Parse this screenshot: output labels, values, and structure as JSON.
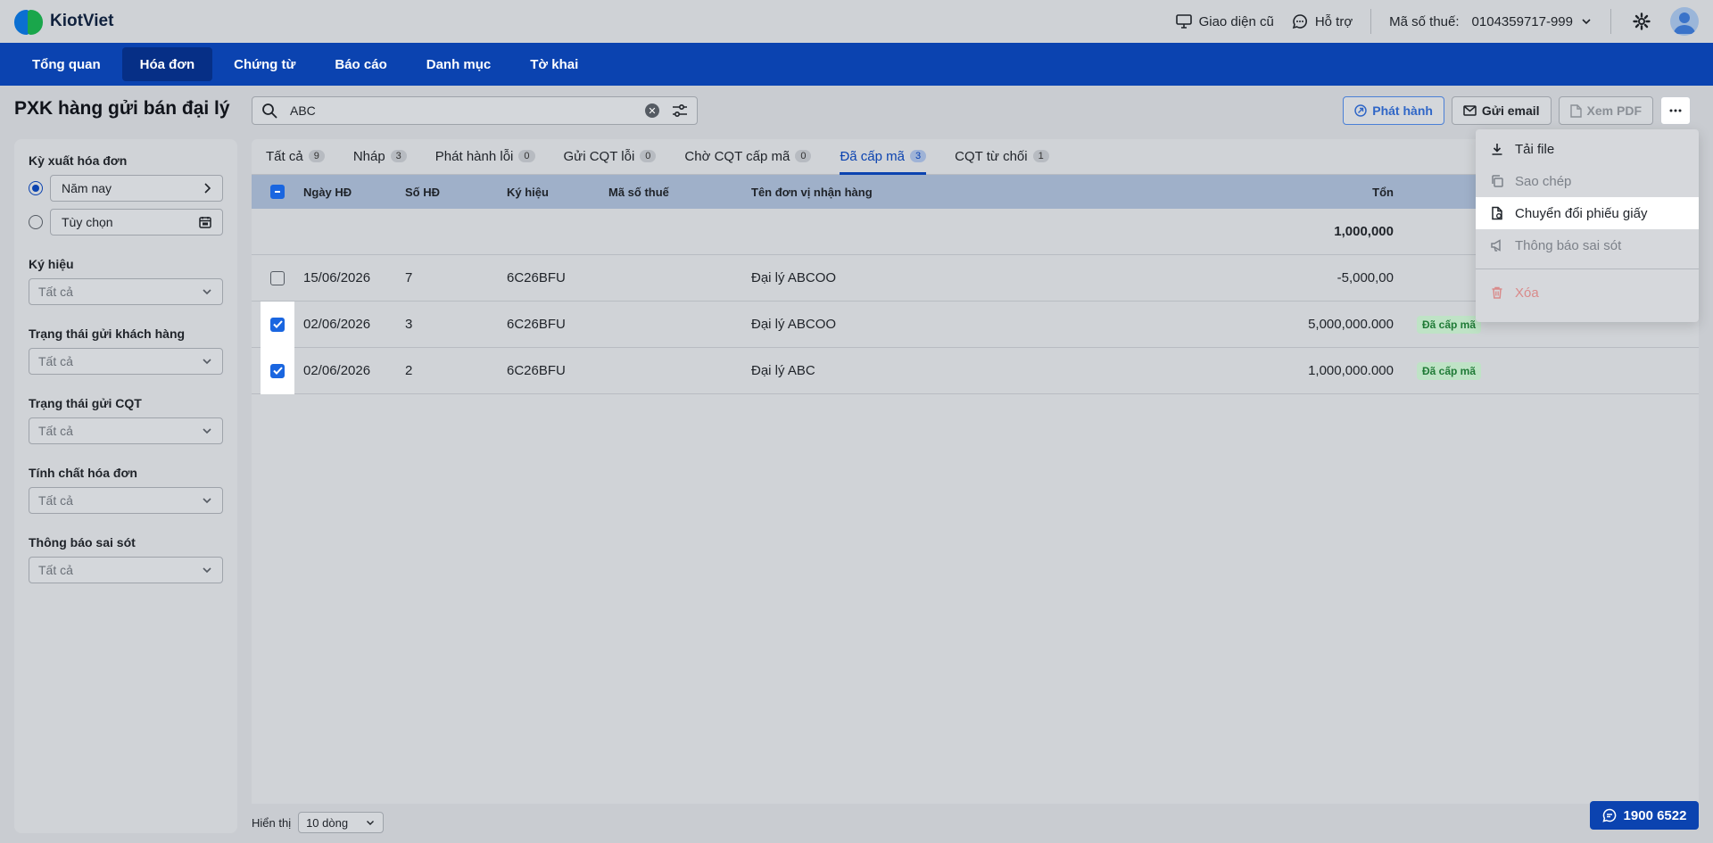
{
  "brand": {
    "name": "KiotViet"
  },
  "header": {
    "old_ui": "Giao diện cũ",
    "support": "Hỗ trợ",
    "tax_label": "Mã số thuế:",
    "tax_value": "0104359717-999"
  },
  "nav": {
    "items": [
      "Tổng quan",
      "Hóa đơn",
      "Chứng từ",
      "Báo cáo",
      "Danh mục",
      "Tờ khai"
    ],
    "active": "Hóa đơn"
  },
  "page": {
    "title": "PXK hàng gửi bán đại lý"
  },
  "search": {
    "value": "ABC"
  },
  "actions": {
    "publish": "Phát hành",
    "email": "Gửi email",
    "pdf": "Xem PDF"
  },
  "filters": {
    "period_label": "Kỳ xuất hóa đơn",
    "period_option1": "Năm nay",
    "period_option2": "Tùy chọn",
    "symbol_label": "Ký hiệu",
    "customer_status_label": "Trạng thái gửi khách hàng",
    "cqt_status_label": "Trạng thái gửi CQT",
    "nature_label": "Tính chất hóa đơn",
    "error_label": "Thông báo sai sót",
    "all": "Tất cả"
  },
  "tabs": [
    {
      "label": "Tất cả",
      "count": "9"
    },
    {
      "label": "Nháp",
      "count": "3"
    },
    {
      "label": "Phát hành lỗi",
      "count": "0"
    },
    {
      "label": "Gửi CQT lỗi",
      "count": "0"
    },
    {
      "label": "Chờ CQT cấp mã",
      "count": "0"
    },
    {
      "label": "Đã cấp mã",
      "count": "3"
    },
    {
      "label": "CQT từ chối",
      "count": "1"
    }
  ],
  "table": {
    "columns": {
      "date": "Ngày HĐ",
      "number": "Số HĐ",
      "symbol": "Ký hiệu",
      "tax": "Mã số thuế",
      "name": "Tên đơn vị nhận hàng",
      "total": "Tổn"
    },
    "sum_total": "1,000,000",
    "rows": [
      {
        "date": "15/06/2026",
        "number": "7",
        "symbol": "6C26BFU",
        "tax": "",
        "name": "Đại lý ABCOO",
        "total": "-5,000,00",
        "status": ""
      },
      {
        "date": "02/06/2026",
        "number": "3",
        "symbol": "6C26BFU",
        "tax": "",
        "name": "Đại lý ABCOO",
        "total": "5,000,000.000",
        "status": "Đã cấp mã"
      },
      {
        "date": "02/06/2026",
        "number": "2",
        "symbol": "6C26BFU",
        "tax": "",
        "name": "Đại lý ABC",
        "total": "1,000,000.000",
        "status": "Đã cấp mã"
      }
    ]
  },
  "footer": {
    "show_label": "Hiển thị",
    "page_size": "10 dòng"
  },
  "hotline": "1900 6522",
  "menu": {
    "download": "Tải file",
    "copy": "Sao chép",
    "convert": "Chuyển đổi phiếu giấy",
    "error_notice": "Thông báo sai sót",
    "delete": "Xóa"
  },
  "colors": {
    "brand_blue": "#0b43b0",
    "checkbox_blue": "#1a66e0",
    "badge_green": "#1f7a36"
  }
}
